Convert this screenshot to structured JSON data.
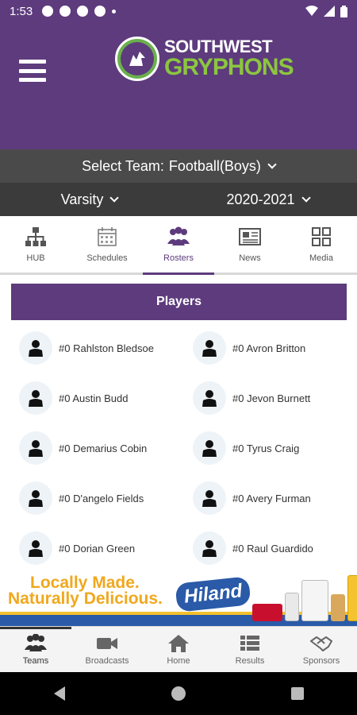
{
  "status": {
    "time": "1:53"
  },
  "header": {
    "logo_top": "SOUTHWEST",
    "logo_bottom": "GRYPHONS"
  },
  "team_select": {
    "label": "Select Team:",
    "value": "Football(Boys)"
  },
  "filters": {
    "level": "Varsity",
    "season": "2020-2021"
  },
  "tabs": [
    {
      "label": "HUB",
      "icon": "org-chart-icon"
    },
    {
      "label": "Schedules",
      "icon": "calendar-icon"
    },
    {
      "label": "Rosters",
      "icon": "people-icon",
      "active": true
    },
    {
      "label": "News",
      "icon": "newspaper-icon"
    },
    {
      "label": "Media",
      "icon": "grid-icon"
    }
  ],
  "players": {
    "title": "Players",
    "list": [
      "#0 Rahlston Bledsoe",
      "#0 Avron Britton",
      "#0 Austin Budd",
      "#0 Jevon Burnett",
      "#0 Demarius Cobin",
      "#0 Tyrus Craig",
      "#0 D'angelo Fields",
      "#0 Avery Furman",
      "#0 Dorian Green",
      "#0 Raul Guardido"
    ]
  },
  "ad": {
    "line1": "Locally Made.",
    "line2": "Naturally Delicious.",
    "brand": "Hiland"
  },
  "bottom_nav": [
    {
      "label": "Teams",
      "icon": "teams-icon",
      "active": true
    },
    {
      "label": "Broadcasts",
      "icon": "video-camera-icon"
    },
    {
      "label": "Home",
      "icon": "home-icon"
    },
    {
      "label": "Results",
      "icon": "list-icon"
    },
    {
      "label": "Sponsors",
      "icon": "handshake-icon"
    }
  ],
  "colors": {
    "primary": "#5d3b7d",
    "accent_green": "#8cc63f",
    "bar_dark": "#3b3b3b"
  }
}
